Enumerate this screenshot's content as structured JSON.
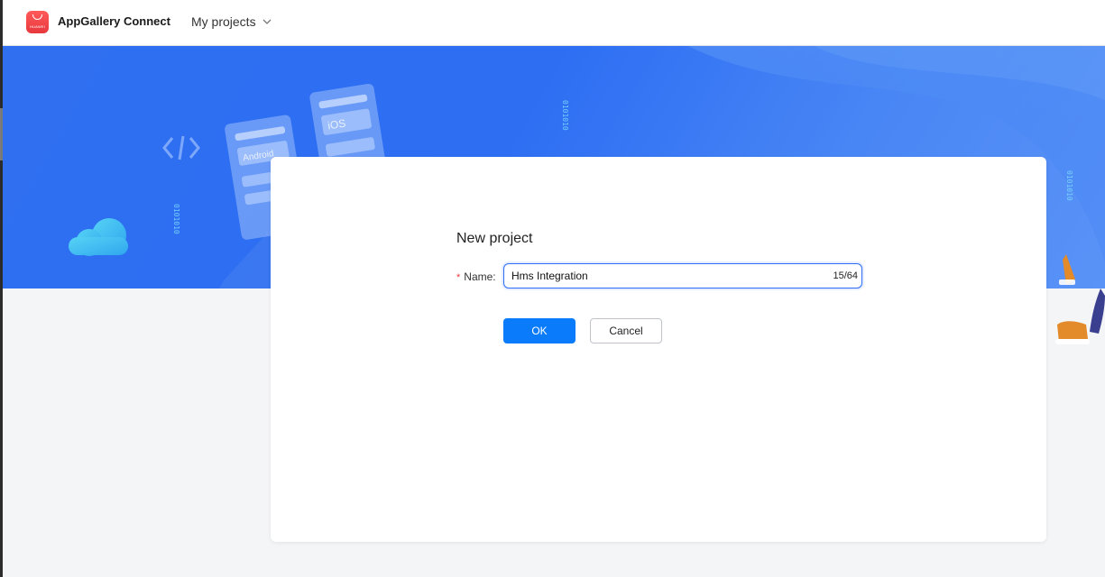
{
  "header": {
    "brand_mark": "HUAWEI",
    "app_name": "AppGallery Connect",
    "projects_menu": "My projects"
  },
  "banner": {
    "card_android": "Android",
    "card_ios": "iOS",
    "code_glyph": "</>",
    "binary_text": "0101010"
  },
  "dialog": {
    "title": "New project",
    "name_label": "Name:",
    "required_mark": "*",
    "name_value": "Hms Integration",
    "char_counter": "15/64",
    "ok_label": "OK",
    "cancel_label": "Cancel"
  },
  "colors": {
    "brand_red": "#e8383d",
    "primary_blue": "#0a7cfb",
    "banner_blue": "#2f6ff0",
    "focus_blue": "#2e6ef6"
  }
}
